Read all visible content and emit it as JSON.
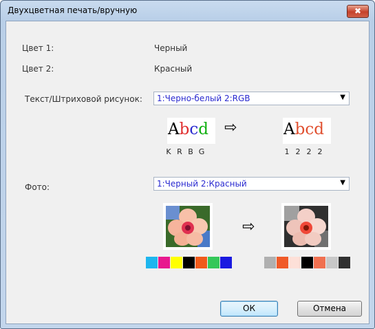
{
  "window": {
    "title": "Двухцветная печать/вручную",
    "close_glyph": "✖"
  },
  "colors": {
    "color1_label": "Цвет 1:",
    "color1_value": "Черный",
    "color2_label": "Цвет 2:",
    "color2_value": "Красный"
  },
  "text": {
    "label": "Текст/Штриховой рисунок:",
    "selected": "1:Черно-белый 2:RGB",
    "sample_before": {
      "letters": [
        "A",
        "b",
        "c",
        "d"
      ],
      "colors": [
        "#000000",
        "#e03030",
        "#2a2ad0",
        "#10b010"
      ],
      "codes": [
        "K",
        "R",
        "B",
        "G"
      ]
    },
    "sample_after": {
      "letters": [
        "A",
        "b",
        "c",
        "d"
      ],
      "colors": [
        "#000000",
        "#e05030",
        "#e05030",
        "#e05030"
      ],
      "codes": [
        "1",
        "2",
        "2",
        "2"
      ]
    }
  },
  "photo": {
    "label": "Фото:",
    "selected": "1:Черный 2:Красный",
    "swatches_before": [
      "#1eb6ee",
      "#e8188e",
      "#ffff00",
      "#000000",
      "#f05a1a",
      "#34c759",
      "#1a1ae0"
    ],
    "swatches_after": [
      "#b0b0b0",
      "#f05a28",
      "#fde0d8",
      "#000000",
      "#f07050",
      "#c8c8c8",
      "#303030"
    ]
  },
  "icons": {
    "arrow": "⇨",
    "dropdown": "▼"
  },
  "buttons": {
    "ok": "ОК",
    "cancel": "Отмена"
  }
}
